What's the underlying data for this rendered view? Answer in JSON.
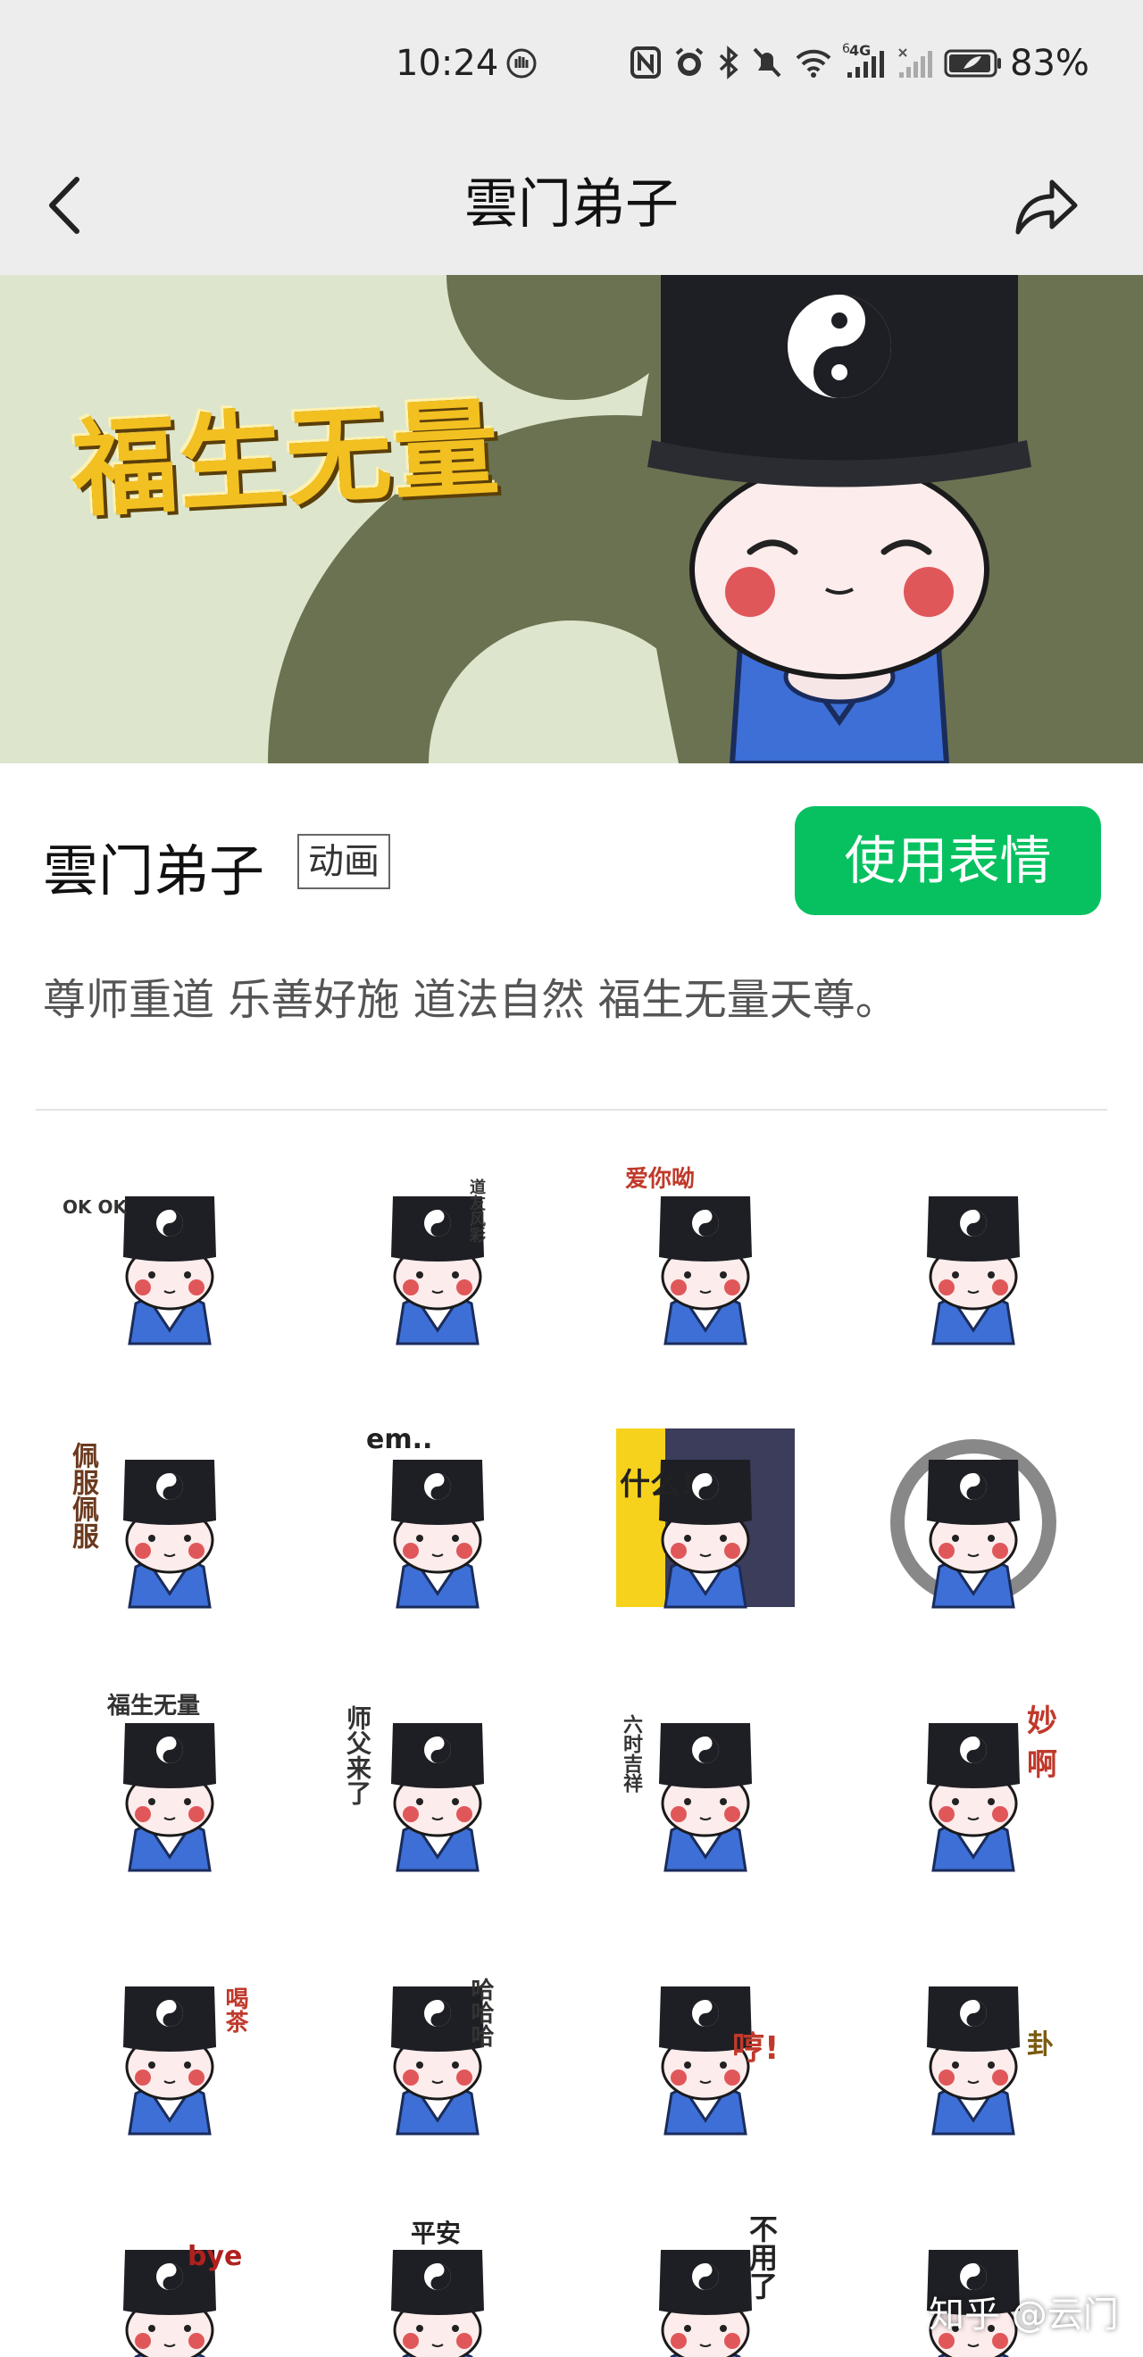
{
  "status_bar": {
    "time": "10:24",
    "network": "4G",
    "network_sim": "6",
    "battery": "83%",
    "icons": [
      "nfc-icon",
      "alarm-icon",
      "bluetooth-icon",
      "mute-icon",
      "wifi-icon",
      "signal-icon",
      "signal-icon-2",
      "battery-icon"
    ]
  },
  "nav": {
    "title": "雲门弟子",
    "back_icon": "chevron-left-icon",
    "share_icon": "share-icon"
  },
  "banner": {
    "title": "福生无量"
  },
  "pack": {
    "name": "雲门弟子",
    "badge": "动画",
    "use_button": "使用表情",
    "description": "尊师重道 乐善好施 道法自然 福生无量天尊。"
  },
  "colors": {
    "accent": "#07c160",
    "banner_bg": "#dde6cc",
    "banner_dark": "#6b7251",
    "robe": "#3d6fd6",
    "hat": "#1e1f24"
  },
  "stickers": [
    {
      "caption": "OK OK"
    },
    {
      "caption": "道友风彩"
    },
    {
      "caption": "爱你呦"
    },
    {
      "caption": ""
    },
    {
      "caption": "佩服佩服"
    },
    {
      "caption": "em.."
    },
    {
      "caption": "什么!"
    },
    {
      "caption": ""
    },
    {
      "caption": "福生无量"
    },
    {
      "caption": "师父来了"
    },
    {
      "caption": "六时吉祥"
    },
    {
      "caption": "妙啊"
    },
    {
      "caption": "喝茶"
    },
    {
      "caption": "哈哈哈"
    },
    {
      "caption": "哼!"
    },
    {
      "caption": "卦"
    },
    {
      "caption": "bye"
    },
    {
      "caption": "平安"
    },
    {
      "caption": "不用了"
    },
    {
      "caption": ""
    }
  ],
  "watermark": "知乎 @云门"
}
